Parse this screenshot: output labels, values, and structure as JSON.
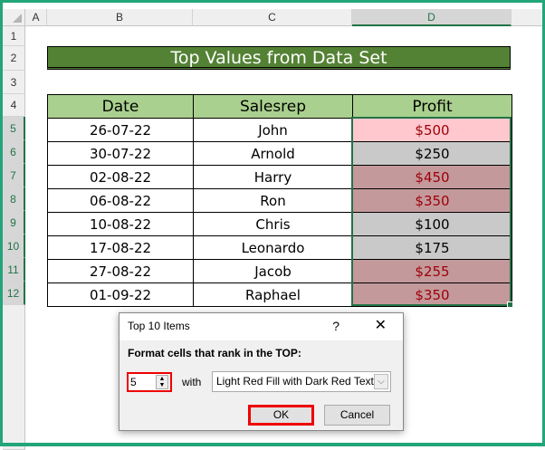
{
  "columns": [
    "A",
    "B",
    "C",
    "D"
  ],
  "rows": [
    "1",
    "2",
    "3",
    "4",
    "5",
    "6",
    "7",
    "8",
    "9",
    "10",
    "11",
    "12"
  ],
  "title": "Top Values from Data Set",
  "headers": [
    "Date",
    "Salesrep",
    "Profit"
  ],
  "data": [
    {
      "date": "26-07-22",
      "rep": "John",
      "profit": "$500",
      "top": true
    },
    {
      "date": "30-07-22",
      "rep": "Arnold",
      "profit": "$250",
      "top": false
    },
    {
      "date": "02-08-22",
      "rep": "Harry",
      "profit": "$450",
      "top": true
    },
    {
      "date": "06-08-22",
      "rep": "Ron",
      "profit": "$350",
      "top": true
    },
    {
      "date": "10-08-22",
      "rep": "Chris",
      "profit": "$100",
      "top": false
    },
    {
      "date": "17-08-22",
      "rep": "Leonardo",
      "profit": "$175",
      "top": false
    },
    {
      "date": "27-08-22",
      "rep": "Jacob",
      "profit": "$255",
      "top": true
    },
    {
      "date": "01-09-22",
      "rep": "Raphael",
      "profit": "$350",
      "top": true
    }
  ],
  "dialog": {
    "title": "Top 10 Items",
    "help": "?",
    "close": "✕",
    "label": "Format cells that rank in the TOP:",
    "value": "5",
    "with": "with",
    "format": "Light Red Fill with Dark Red Text",
    "ok": "OK",
    "cancel": "Cancel"
  },
  "colors": {
    "top_fill": "#ffc7ce",
    "top_text": "#9c0006",
    "header_fill": "#a9d08e",
    "title_fill": "#548235"
  }
}
